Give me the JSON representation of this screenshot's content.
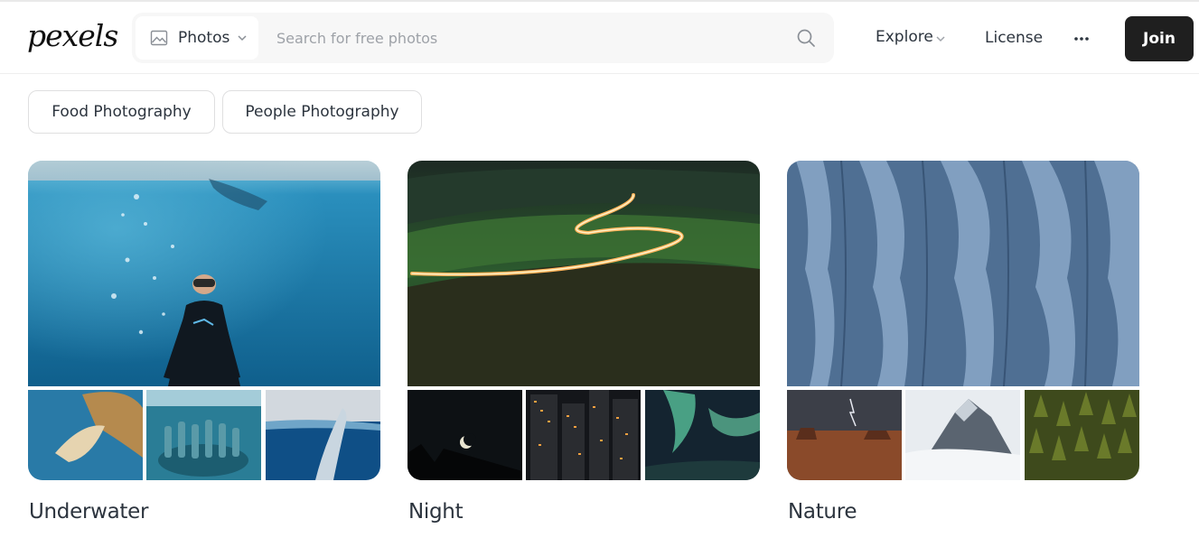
{
  "brand": {
    "logo_text": "pexels"
  },
  "search": {
    "type_label": "Photos",
    "placeholder": "Search for free photos"
  },
  "nav": {
    "explore_label": "Explore",
    "license_label": "License",
    "more_icon": "ellipsis-icon",
    "join_label": "Join"
  },
  "chips": [
    {
      "label": "Food Photography"
    },
    {
      "label": "People Photography"
    }
  ],
  "collections": [
    {
      "title": "Underwater"
    },
    {
      "title": "Night"
    },
    {
      "title": "Nature"
    }
  ],
  "colors": {
    "join_bg": "#1f1f1f",
    "search_bg": "#f7f7f7",
    "text": "#2c343e"
  }
}
